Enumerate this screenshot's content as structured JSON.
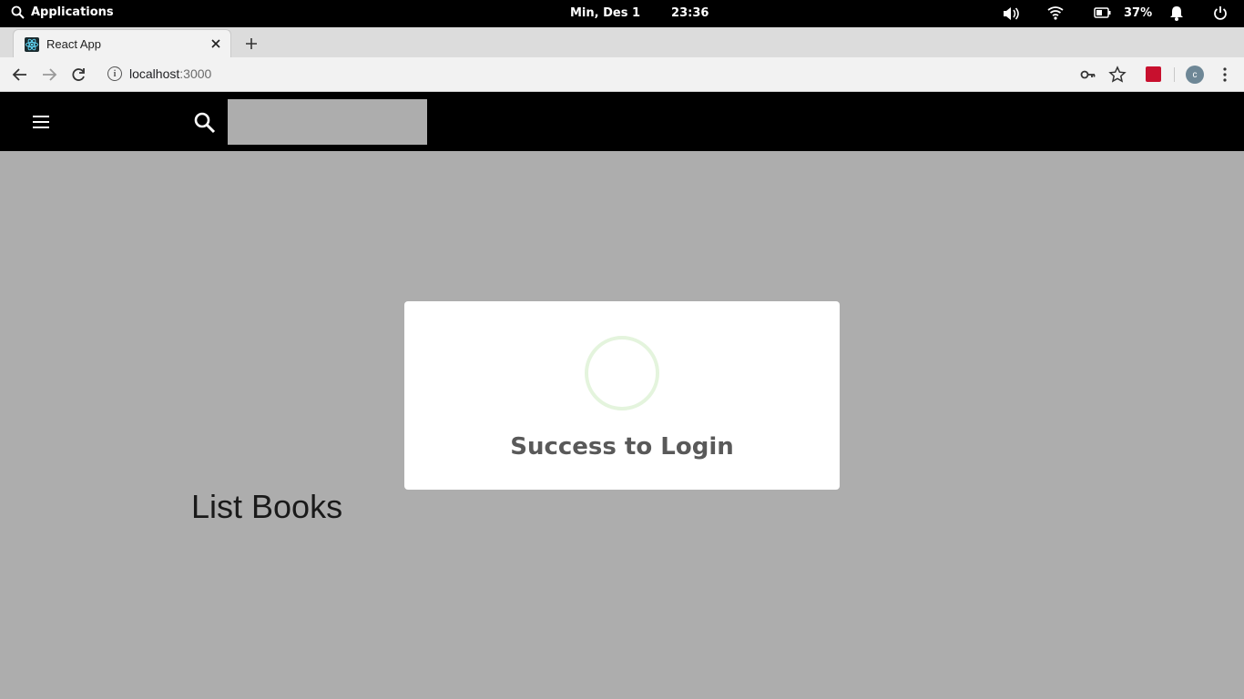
{
  "system_bar": {
    "apps_label": "Applications",
    "date": "Min, Des 1",
    "time": "23:36",
    "battery_percent": "37%"
  },
  "browser": {
    "tab_title": "React App",
    "url_host": "localhost",
    "url_port": ":3000",
    "avatar_letter": "c"
  },
  "app": {
    "search_placeholder": "",
    "heading": "List Books"
  },
  "modal": {
    "title": "Success to Login"
  },
  "colors": {
    "spinner": "#e4f4dd",
    "overlay": "#adadad",
    "appbar": "#000000"
  }
}
